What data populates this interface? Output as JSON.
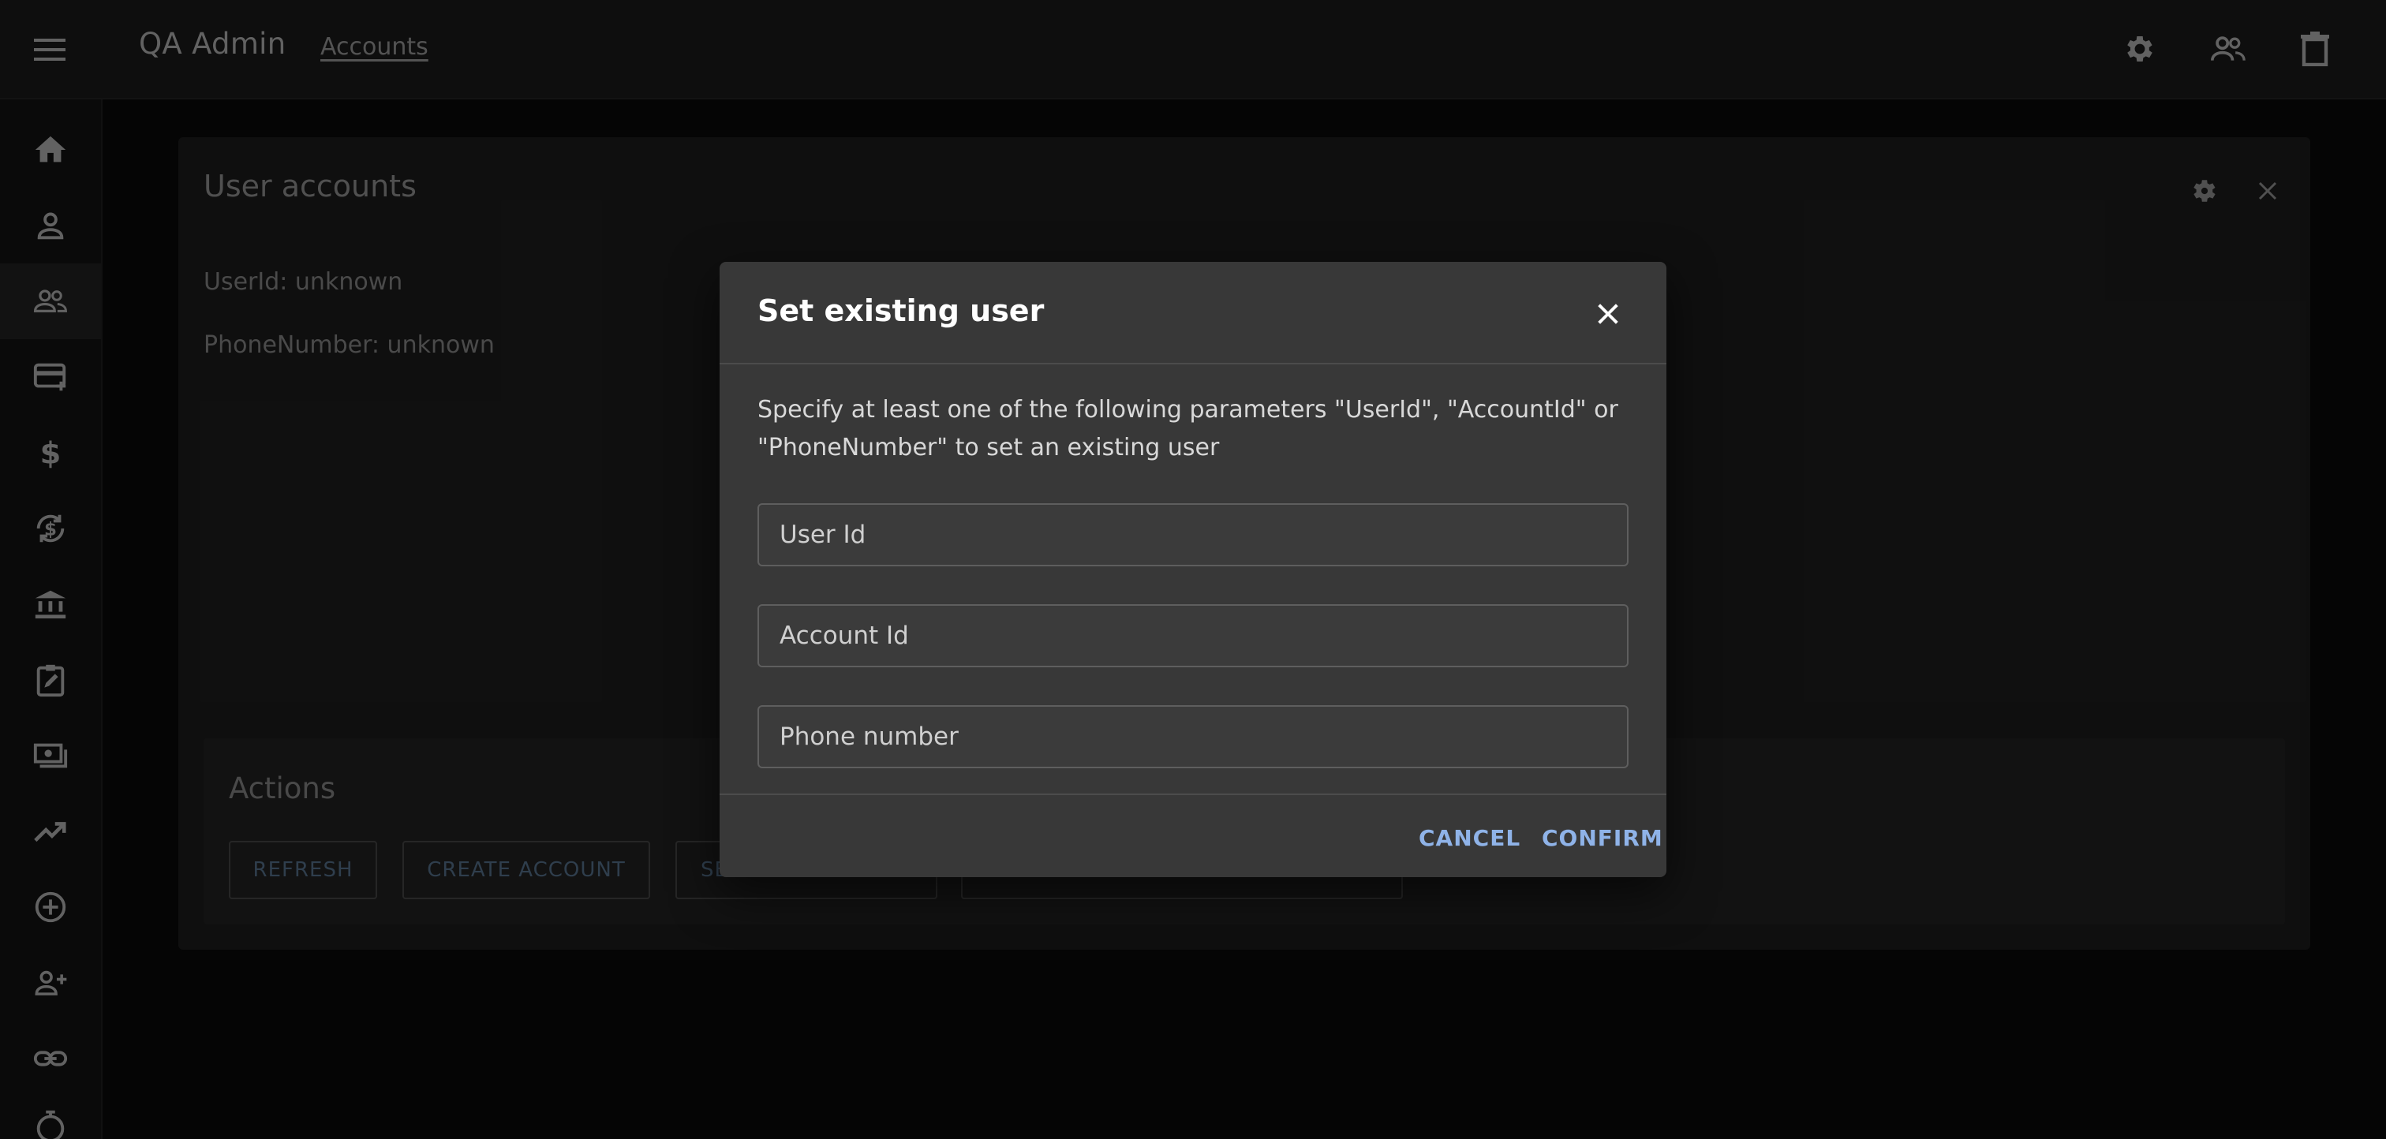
{
  "app": {
    "title": "QA Admin",
    "breadcrumb": "Accounts"
  },
  "topbar_icons": [
    "gear-icon",
    "people-icon",
    "trash-icon"
  ],
  "sidebar": {
    "items": [
      {
        "icon": "home-icon"
      },
      {
        "icon": "person-icon"
      },
      {
        "icon": "people-icon",
        "active": true
      },
      {
        "icon": "card-add-icon"
      },
      {
        "icon": "dollar-icon"
      },
      {
        "icon": "currency-exchange-icon"
      },
      {
        "icon": "bank-icon"
      },
      {
        "icon": "clipboard-edit-icon"
      },
      {
        "icon": "payments-icon"
      },
      {
        "icon": "trending-up-icon"
      },
      {
        "icon": "add-circle-icon"
      },
      {
        "icon": "person-add-icon"
      },
      {
        "icon": "link-icon"
      },
      {
        "icon": "timer-icon"
      }
    ]
  },
  "card": {
    "title": "User accounts",
    "user_id_line": "UserId: unknown",
    "phone_line": "PhoneNumber: unknown",
    "actions_title": "Actions",
    "buttons": {
      "refresh": "REFRESH",
      "create_account": "CREATE ACCOUNT",
      "set_existing_partial": "SE",
      "fourth": ""
    }
  },
  "dialog": {
    "title": "Set existing user",
    "description": "Specify at least one of the following parameters \"UserId\", \"AccountId\" or \"PhoneNumber\" to set an existing user",
    "fields": {
      "user_id_placeholder": "User Id",
      "account_id_placeholder": "Account Id",
      "phone_placeholder": "Phone number"
    },
    "cancel_label": "CANCEL",
    "confirm_label": "CONFIRM"
  },
  "colors": {
    "accent": "#8fb3e8",
    "dialog_bg": "#383838",
    "topbar_bg": "#1c1c1c"
  }
}
